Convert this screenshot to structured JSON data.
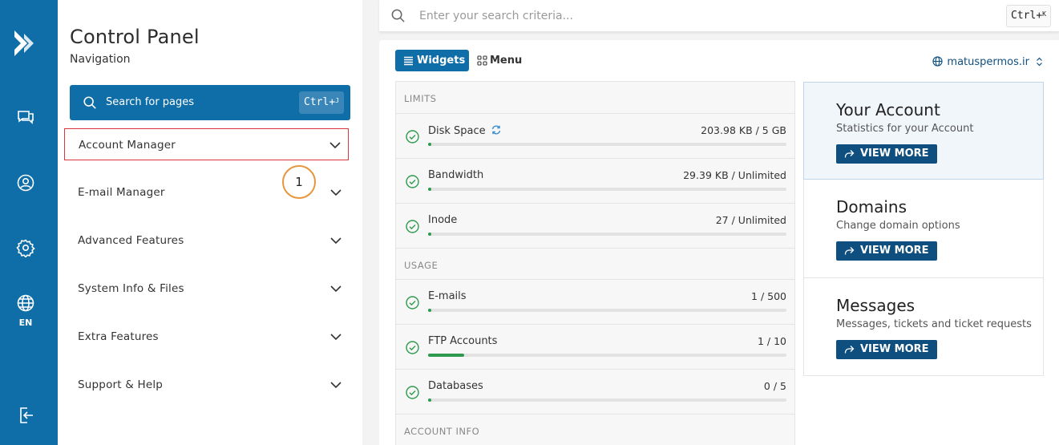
{
  "rail": {
    "language": "EN",
    "icons": [
      "logo-icon",
      "chat-icon",
      "user-icon",
      "settings-icon",
      "globe-icon",
      "logout-icon"
    ]
  },
  "nav": {
    "title": "Control Panel",
    "subtitle": "Navigation",
    "search_label": "Search for pages",
    "search_shortcut": "Ctrl+",
    "search_shortcut_key": "J",
    "items": [
      {
        "label": "Account Manager"
      },
      {
        "label": "E-mail Manager"
      },
      {
        "label": "Advanced Features"
      },
      {
        "label": "System Info & Files"
      },
      {
        "label": "Extra Features"
      },
      {
        "label": "Support & Help"
      }
    ],
    "annotation_number": "1"
  },
  "topsearch": {
    "placeholder": "Enter your search criteria...",
    "shortcut": "Ctrl+",
    "shortcut_key": "K"
  },
  "main": {
    "tabs": {
      "widgets": "Widgets",
      "menu": "Menu"
    },
    "domain": "matuspermos.ir",
    "sections": {
      "limits": "LIMITS",
      "usage": "USAGE",
      "account_info": "ACCOUNT INFO"
    },
    "limits": [
      {
        "label": "Disk Space",
        "value": "203.98 KB / 5 GB",
        "percent": 1
      },
      {
        "label": "Bandwidth",
        "value": "29.39 KB / Unlimited",
        "percent": 1
      },
      {
        "label": "Inode",
        "value": "27 / Unlimited",
        "percent": 1
      }
    ],
    "usage": [
      {
        "label": "E-mails",
        "value": "1 / 500",
        "percent": 1
      },
      {
        "label": "FTP Accounts",
        "value": "1 / 10",
        "percent": 10
      },
      {
        "label": "Databases",
        "value": "0 / 5",
        "percent": 1
      }
    ],
    "cards": [
      {
        "title": "Your Account",
        "desc": "Statistics for your Account",
        "button": "VIEW MORE"
      },
      {
        "title": "Domains",
        "desc": "Change domain options",
        "button": "VIEW MORE"
      },
      {
        "title": "Messages",
        "desc": "Messages, tickets and ticket requests",
        "button": "VIEW MORE"
      }
    ]
  },
  "colors": {
    "primary": "#0f6ea8",
    "dark_button": "#0f4f80",
    "success": "#2e9a4e",
    "active_border": "#d9363e",
    "annotation": "#e8963c"
  }
}
